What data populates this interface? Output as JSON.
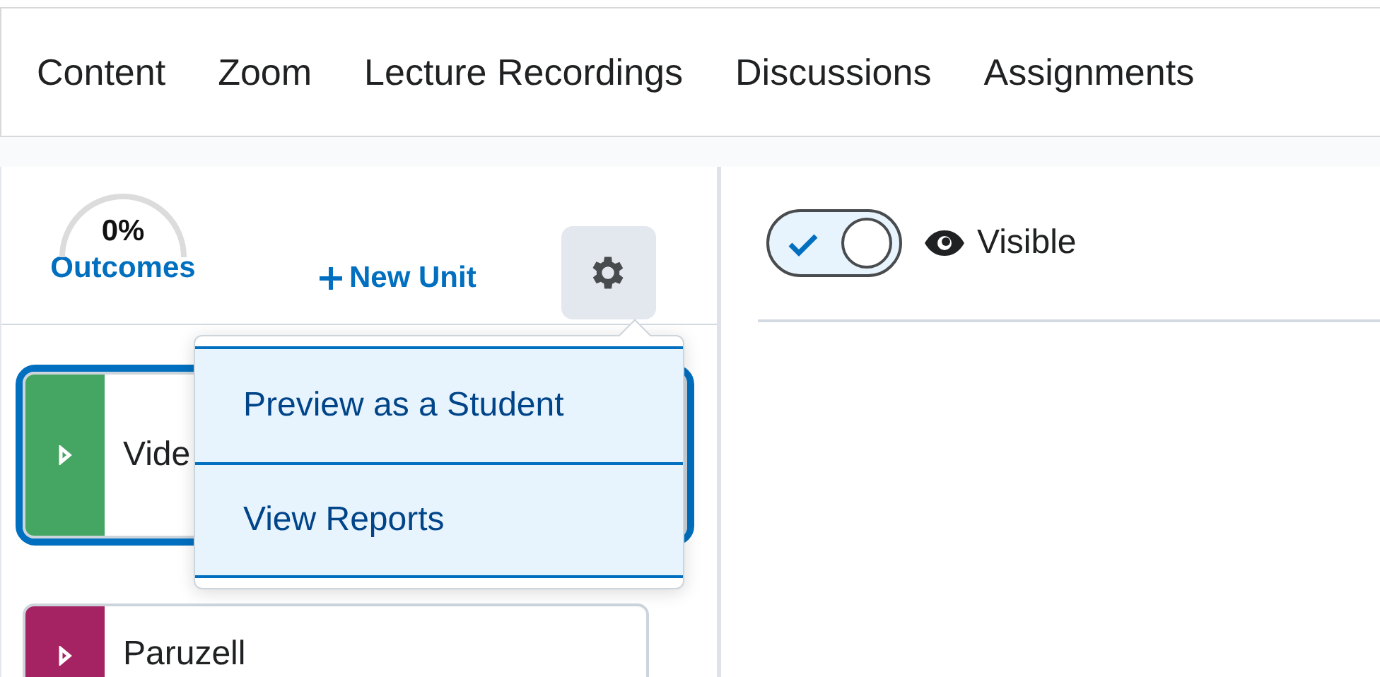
{
  "nav_tabs": [
    {
      "label": "Content"
    },
    {
      "label": "Zoom"
    },
    {
      "label": "Lecture Recordings"
    },
    {
      "label": "Discussions"
    },
    {
      "label": "Assignments"
    }
  ],
  "outcomes": {
    "percent": "0%",
    "label": "Outcomes"
  },
  "new_unit": "New Unit",
  "settings_menu": {
    "expanded": true,
    "items": [
      {
        "label": "Preview as a Student"
      },
      {
        "label": "View Reports"
      }
    ]
  },
  "units": [
    {
      "title": "Vide",
      "color": "#45a562",
      "selected": true
    },
    {
      "title": "Paruzell",
      "color": "#a52362",
      "selected": false
    }
  ],
  "visibility": {
    "on": true,
    "label": "Visible"
  }
}
